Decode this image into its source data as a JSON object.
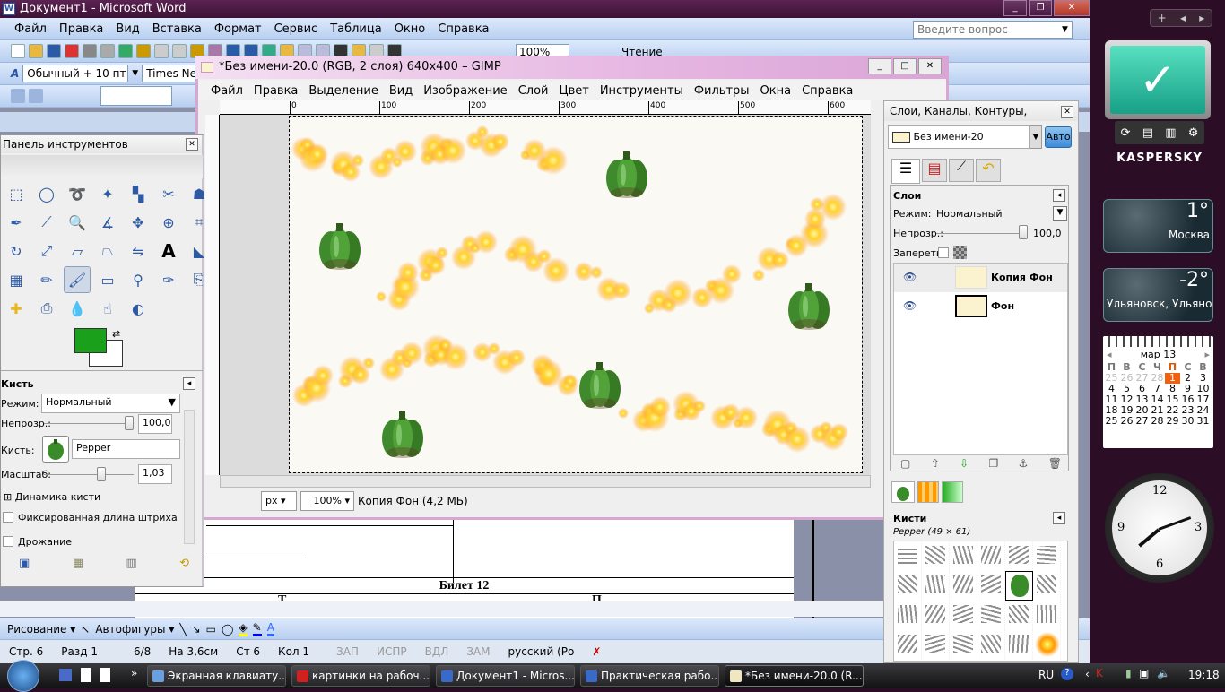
{
  "word": {
    "title": "Документ1 - Microsoft Word",
    "menu": [
      "Файл",
      "Правка",
      "Вид",
      "Вставка",
      "Формат",
      "Сервис",
      "Таблица",
      "Окно",
      "Справка"
    ],
    "ask_placeholder": "Введите вопрос",
    "style": "Обычный + 10 пт",
    "font": "Times New",
    "zoom": "100%",
    "read_label": "Чтение",
    "doc_heading": "Билет 12",
    "col1_partial": "Т",
    "col2_partial": "П",
    "draw_label": "Рисование",
    "autoshapes_label": "Автофигуры",
    "status": {
      "page": "Стр. 6",
      "section": "Разд 1",
      "pages": "6/8",
      "at": "На 3,6см",
      "line": "Ст 6",
      "col": "Кол 1",
      "rec": "ЗАП",
      "trk": "ИСПР",
      "ext": "ВДЛ",
      "ovr": "ЗАМ",
      "lang": "русский (Ро"
    }
  },
  "gimp": {
    "title": "*Без имени-20.0 (RGB, 2 слоя) 640x400 – GIMP",
    "menu": [
      "Файл",
      "Правка",
      "Выделение",
      "Вид",
      "Изображение",
      "Слой",
      "Цвет",
      "Инструменты",
      "Фильтры",
      "Окна",
      "Справка"
    ],
    "ruler_ticks": [
      "0",
      "100",
      "200",
      "300",
      "400",
      "500",
      "600"
    ],
    "unit": "px",
    "zoom": "100%",
    "status": "Копия Фон (4,2 МБ)"
  },
  "toolbox": {
    "title": "Панель инструментов",
    "tools": [
      "rect-select-icon",
      "ellipse-select-icon",
      "lasso-icon",
      "fuzzy-select-icon",
      "color-select-icon",
      "scissors-icon",
      "foreground-select-icon",
      "paths-icon",
      "color-picker-icon",
      "zoom-icon",
      "measure-icon",
      "move-icon",
      "align-icon",
      "crop-icon",
      "rotate-icon",
      "scale-icon",
      "shear-icon",
      "perspective-icon",
      "flip-icon",
      "text-icon",
      "bucket-fill-icon",
      "blend-icon",
      "pencil-icon",
      "paintbrush-icon",
      "eraser-icon",
      "airbrush-icon",
      "ink-icon",
      "clone-icon",
      "heal-icon",
      "perspective-clone-icon",
      "blur-icon",
      "smudge-icon",
      "dodge-burn-icon"
    ],
    "fg_color": "#1aa01a",
    "bg_color": "#ffffff",
    "brush": {
      "title": "Кисть",
      "mode_label": "Режим:",
      "mode": "Нормальный",
      "opacity_label": "Непрозр.:",
      "opacity": "100,0",
      "brush_label": "Кисть:",
      "brush_name": "Pepper",
      "scale_label": "Масштаб:",
      "scale": "1,03",
      "dynamics": "Динамика кисти",
      "fixed_length": "Фиксированная длина штриха",
      "jitter": "Дрожание"
    }
  },
  "dock": {
    "title": "Слои, Каналы, Контуры, Отмени...",
    "image": "Без имени-20",
    "auto": "Авто",
    "layers_title": "Слои",
    "mode_label": "Режим:",
    "mode": "Нормальный",
    "opacity_label": "Непрозр.:",
    "opacity": "100,0",
    "lock_label": "Запереть:",
    "layers": [
      {
        "name": "Копия Фон",
        "selected": true
      },
      {
        "name": "Фон",
        "selected": false
      }
    ],
    "brushes_title": "Кисти",
    "brush_info": "Pepper (49 × 61)"
  },
  "gadgets": {
    "kaspersky": "KASPERSKY",
    "weather": [
      {
        "temp": "1°",
        "city": "Москва"
      },
      {
        "temp": "-2°",
        "city": "Ульяновск, Ульяно..."
      }
    ],
    "calendar": {
      "month": "мар 13",
      "days": [
        "П",
        "В",
        "С",
        "Ч",
        "П",
        "С",
        "В"
      ],
      "weeks": [
        [
          "25",
          "26",
          "27",
          "28",
          "1",
          "2",
          "3"
        ],
        [
          "4",
          "5",
          "6",
          "7",
          "8",
          "9",
          "10"
        ],
        [
          "11",
          "12",
          "13",
          "14",
          "15",
          "16",
          "17"
        ],
        [
          "18",
          "19",
          "20",
          "21",
          "22",
          "23",
          "24"
        ],
        [
          "25",
          "26",
          "27",
          "28",
          "29",
          "30",
          "31"
        ]
      ],
      "today": "1"
    }
  },
  "taskbar": {
    "tasks": [
      {
        "label": "Экранная клавиату...",
        "color": "#6aa0e0"
      },
      {
        "label": "картинки на рабоч...",
        "color": "#d02020"
      },
      {
        "label": "Документ1 - Micros...",
        "color": "#3a6ac8"
      },
      {
        "label": "Практическая рабо...",
        "color": "#3a6ac8"
      },
      {
        "label": "*Без имени-20.0 (R...",
        "color": "#f0e6c0",
        "active": true
      }
    ],
    "lang": "RU",
    "time": "19:18"
  }
}
